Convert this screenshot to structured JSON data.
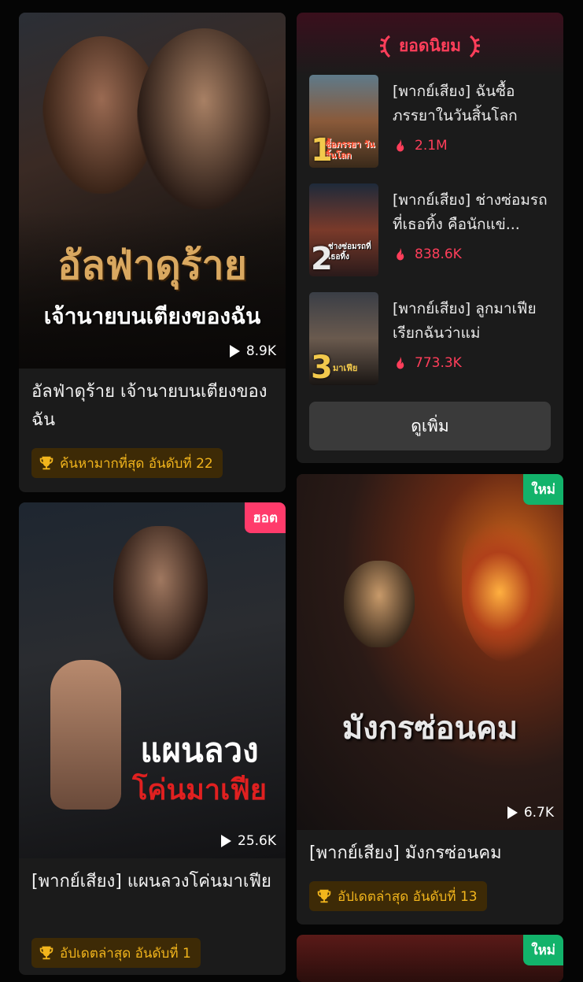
{
  "cards": {
    "alpha": {
      "cover_title_line1": "อัลฟ่าดุร้าย",
      "cover_title_line2": "เจ้านายบนเตียงของฉัน",
      "plays": "8.9K",
      "title": "อัลฟ่าดุร้าย เจ้านายบนเตียงของฉัน",
      "badge": "ค้นหามากที่สุด อันดับที่ 22",
      "icons": {
        "play": "play-icon",
        "trophy": "trophy-icon"
      }
    },
    "mafia": {
      "tag": "ฮอต",
      "tag_color": "#ff3b6b",
      "cover_title_line1": "แผนลวง",
      "cover_title_line2": "โค่นมาเฟีย",
      "plays": "25.6K",
      "title": "[พากย์เสียง] แผนลวงโค่นมาเฟีย",
      "badge": "อัปเดตล่าสุด อันดับที่ 1"
    },
    "dragon": {
      "tag": "ใหม่",
      "tag_color": "#12b36b",
      "cover_title": "มังกรซ่อนคม",
      "plays": "6.7K",
      "title": "[พากย์เสียง] มังกรซ่อนคม",
      "badge": "อัปเดตล่าสุด อันดับที่ 13"
    },
    "next": {
      "tag": "ใหม่"
    }
  },
  "popular": {
    "header": "ยอดนิยม",
    "accent": "#ff3e5a",
    "items": [
      {
        "rank": "1",
        "title": "[พากย์เสียง] ฉันซื้อภรรยาในวันสิ้นโลก",
        "views": "2.1M",
        "thumb_text": "ซื้อภรรยา วันสิ้นโลก"
      },
      {
        "rank": "2",
        "title": "[พากย์เสียง] ช่างซ่อมรถที่เธอทิ้ง คือนักแข่...",
        "views": "838.6K",
        "thumb_text": "ช่างซ่อมรถที่เธอทิ้ง"
      },
      {
        "rank": "3",
        "title": "[พากย์เสียง] ลูกมาเฟียเรียกฉันว่าแม่",
        "views": "773.3K",
        "thumb_text": "มาเฟีย"
      }
    ],
    "more_button": "ดูเพิ่ม"
  }
}
